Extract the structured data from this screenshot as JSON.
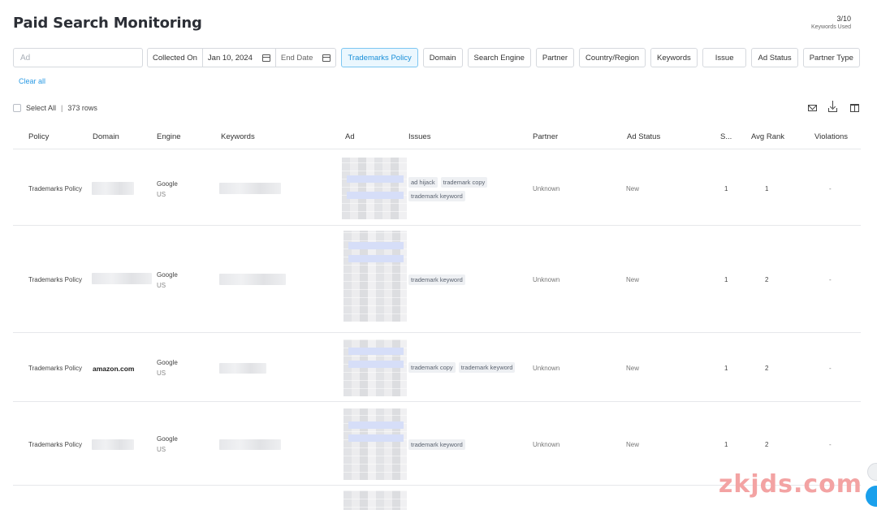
{
  "header": {
    "title": "Paid Search Monitoring",
    "usage_count": "3/10",
    "usage_label": "Keywords Used"
  },
  "filters": {
    "ad_placeholder": "Ad",
    "collected_on_label": "Collected On",
    "start_date": "Jan 10, 2024",
    "end_date_placeholder": "End Date",
    "chips": [
      "Trademarks Policy",
      "Domain",
      "Search Engine",
      "Partner",
      "Country/Region",
      "Keywords",
      "Issue",
      "Ad Status",
      "Partner Type"
    ],
    "active_chip": "Trademarks Policy",
    "clear_all": "Clear all"
  },
  "selection": {
    "select_all": "Select All",
    "separator": "|",
    "rows_count": "373 rows"
  },
  "toolbar": {
    "icons": [
      "mail-icon",
      "download-icon",
      "columns-icon"
    ]
  },
  "table": {
    "columns": [
      "Policy",
      "Domain",
      "Engine",
      "Keywords",
      "Ad",
      "Issues",
      "Partner",
      "Ad Status",
      "S...",
      "Avg Rank",
      "Violations"
    ],
    "rows": [
      {
        "policy": "Trademarks Policy",
        "domain": "",
        "engine": "Google",
        "region": "US",
        "issues": [
          "ad hijack",
          "trademark copy",
          "trademark keyword"
        ],
        "partner": "Unknown",
        "ad_status": "New",
        "s": "1",
        "avg_rank": "1",
        "violations": "-"
      },
      {
        "policy": "Trademarks Policy",
        "domain": "",
        "engine": "Google",
        "region": "US",
        "issues": [
          "trademark keyword"
        ],
        "partner": "Unknown",
        "ad_status": "New",
        "s": "1",
        "avg_rank": "2",
        "violations": "-"
      },
      {
        "policy": "Trademarks Policy",
        "domain": "amazon.com",
        "engine": "Google",
        "region": "US",
        "issues": [
          "trademark copy",
          "trademark keyword"
        ],
        "partner": "Unknown",
        "ad_status": "New",
        "s": "1",
        "avg_rank": "2",
        "violations": "-"
      },
      {
        "policy": "Trademarks Policy",
        "domain": "",
        "engine": "Google",
        "region": "US",
        "issues": [
          "trademark keyword"
        ],
        "partner": "Unknown",
        "ad_status": "New",
        "s": "1",
        "avg_rank": "2",
        "violations": "-"
      }
    ]
  },
  "watermark": "zkjds.com",
  "colors": {
    "accent": "#2a9ae4",
    "active_chip_bg": "#ebf7fe",
    "watermark": "#f3a3a3",
    "help_button": "#1aa0ec"
  }
}
